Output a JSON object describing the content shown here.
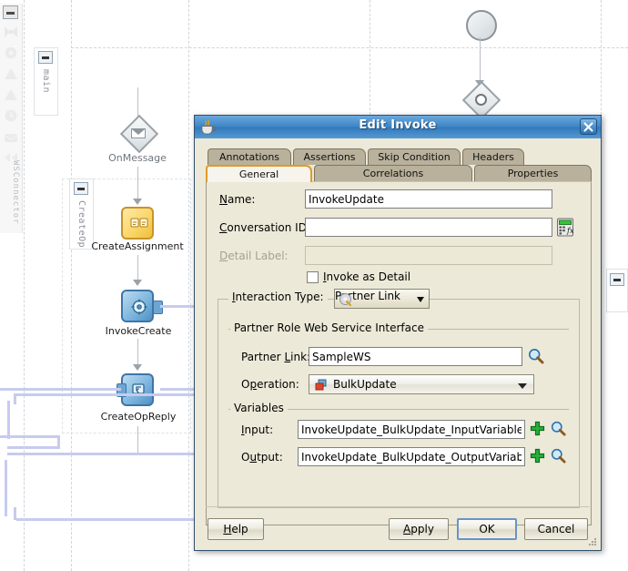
{
  "canvas": {
    "palette": {
      "label": "WSConnector",
      "collapse_icon": "collapse-icon"
    },
    "scopes": [
      {
        "name": "main"
      },
      {
        "name": "CreateOp"
      }
    ],
    "nodes": [
      {
        "id": "start",
        "label": "",
        "icon": "start-circle-icon"
      },
      {
        "id": "receive-gate",
        "label": "",
        "icon": "ring-diamond-icon"
      },
      {
        "id": "onmessage",
        "label": "OnMessage",
        "icon": "envelope-diamond-icon"
      },
      {
        "id": "createassignment",
        "label": "CreateAssignment",
        "icon": "assign-activity-icon"
      },
      {
        "id": "invokecreate",
        "label": "InvokeCreate",
        "icon": "invoke-activity-icon"
      },
      {
        "id": "createopreply",
        "label": "CreateOpReply",
        "icon": "reply-activity-icon"
      }
    ]
  },
  "dialog": {
    "title": "Edit Invoke",
    "title_icon": "java-coffee-cup-icon",
    "close_icon": "close-icon",
    "tabs_row1": [
      {
        "label": "Annotations",
        "selected": false
      },
      {
        "label": "Assertions",
        "selected": false
      },
      {
        "label": "Skip Condition",
        "selected": false
      },
      {
        "label": "Headers",
        "selected": false
      }
    ],
    "tabs_row2": [
      {
        "label": "General",
        "selected": true
      },
      {
        "label": "Correlations",
        "selected": false
      },
      {
        "label": "Properties",
        "selected": false
      }
    ],
    "general": {
      "name_label": "Name:",
      "name_value": "InvokeUpdate",
      "name_placeholder": "",
      "conversation_label": "Conversation ID:",
      "conversation_value": "",
      "conversation_placeholder": "",
      "conversation_icon": "expression-builder-icon",
      "detail_label_label": "Detail Label:",
      "detail_label_value": "",
      "detail_label_placeholder": "",
      "invoke_as_detail_label": "Invoke as Detail",
      "invoke_as_detail_checked": false,
      "interaction_type_label": "Interaction Type:",
      "interaction_type_value": "Partner Link",
      "interaction_type_icon": "partner-link-icon",
      "partner_role_group_title": "Partner Role Web Service Interface",
      "partner_link_label": "Partner Link:",
      "partner_link_value": "SampleWS",
      "partner_link_browse_icon": "magnifier-icon",
      "operation_label": "Operation:",
      "operation_value": "BulkUpdate",
      "operation_icon": "operation-icon",
      "variables_group_title": "Variables",
      "input_label": "Input:",
      "input_value": "InvokeUpdate_BulkUpdate_InputVariable",
      "input_add_icon": "plus-icon",
      "input_browse_icon": "magnifier-icon",
      "output_label": "Output:",
      "output_value": "InvokeUpdate_BulkUpdate_OutputVariable",
      "output_add_icon": "plus-icon",
      "output_browse_icon": "magnifier-icon"
    },
    "buttons": {
      "help": "Help",
      "apply": "Apply",
      "ok": "OK",
      "cancel": "Cancel"
    },
    "resize_grip_icon": "resize-grip-icon"
  },
  "colors": {
    "title_bar_blue": "#3f85c6",
    "dialog_face": "#ece9d8",
    "tab_unselected": "#b9b19c",
    "tab_selected_border": "#e09a28",
    "partner_link_line": "#c7cbee",
    "assign_node": "#fbd66b",
    "invoke_node": "#7fb6dd"
  }
}
